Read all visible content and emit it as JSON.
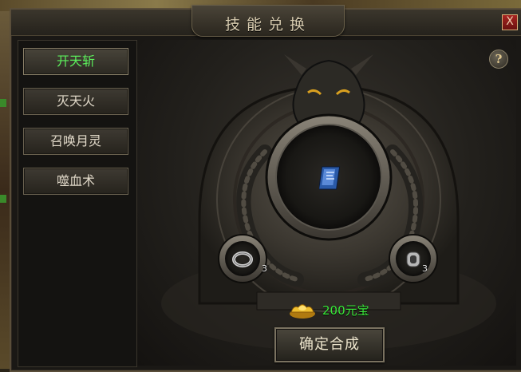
{
  "window": {
    "title": "技能兑换",
    "close_glyph": "X"
  },
  "sidebar": {
    "items": [
      {
        "label": "开天斩",
        "active": true
      },
      {
        "label": "灭天火",
        "active": false
      },
      {
        "label": "召唤月灵",
        "active": false
      },
      {
        "label": "噬血术",
        "active": false
      }
    ]
  },
  "main": {
    "help_glyph": "?",
    "result_item": {
      "icon": "skill-book-icon"
    },
    "materials": [
      {
        "icon": "silver-ring-icon",
        "count": "3"
      },
      {
        "icon": "silver-bracelet-icon",
        "count": "3"
      }
    ],
    "cost": {
      "icon": "gold-ingot-icon",
      "text": "200元宝"
    },
    "confirm_label": "确定合成"
  },
  "colors": {
    "active_item": "#5cf05c",
    "cost_text": "#39e839",
    "close_button": "#a82420"
  }
}
